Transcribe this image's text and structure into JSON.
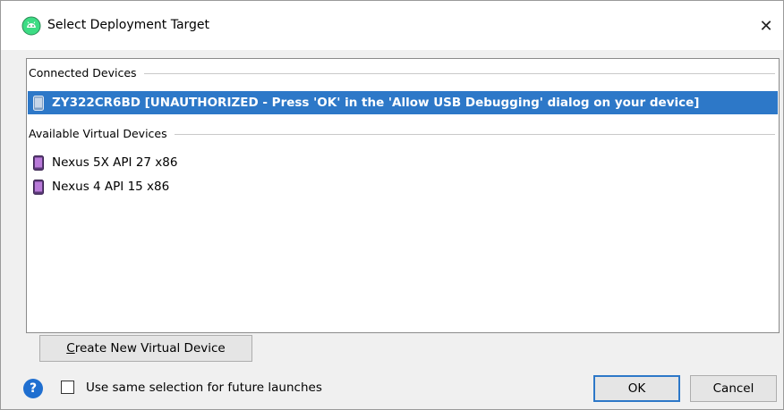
{
  "window": {
    "title": "Select Deployment Target",
    "close_glyph": "✕"
  },
  "groups": [
    {
      "header": "Connected Devices",
      "devices": [
        {
          "label": "ZY322CR6BD [UNAUTHORIZED - Press 'OK' in the 'Allow USB Debugging' dialog on your device]",
          "icon": "physical-device-icon",
          "selected": true
        }
      ]
    },
    {
      "header": "Available Virtual Devices",
      "devices": [
        {
          "label": "Nexus 5X API 27 x86",
          "icon": "virtual-device-icon",
          "selected": false
        },
        {
          "label": "Nexus 4 API 15 x86",
          "icon": "virtual-device-icon",
          "selected": false
        }
      ]
    }
  ],
  "buttons": {
    "create_mnemonic": "C",
    "create_rest": "reate New Virtual Device",
    "ok": "OK",
    "cancel": "Cancel"
  },
  "footer": {
    "help_glyph": "?",
    "same_selection_label": "Use same selection for future launches",
    "same_selection_checked": false
  },
  "colors": {
    "selection": "#2d78c8",
    "virtual_device_icon": "#8e44ad",
    "help_icon": "#1f6fd0"
  }
}
